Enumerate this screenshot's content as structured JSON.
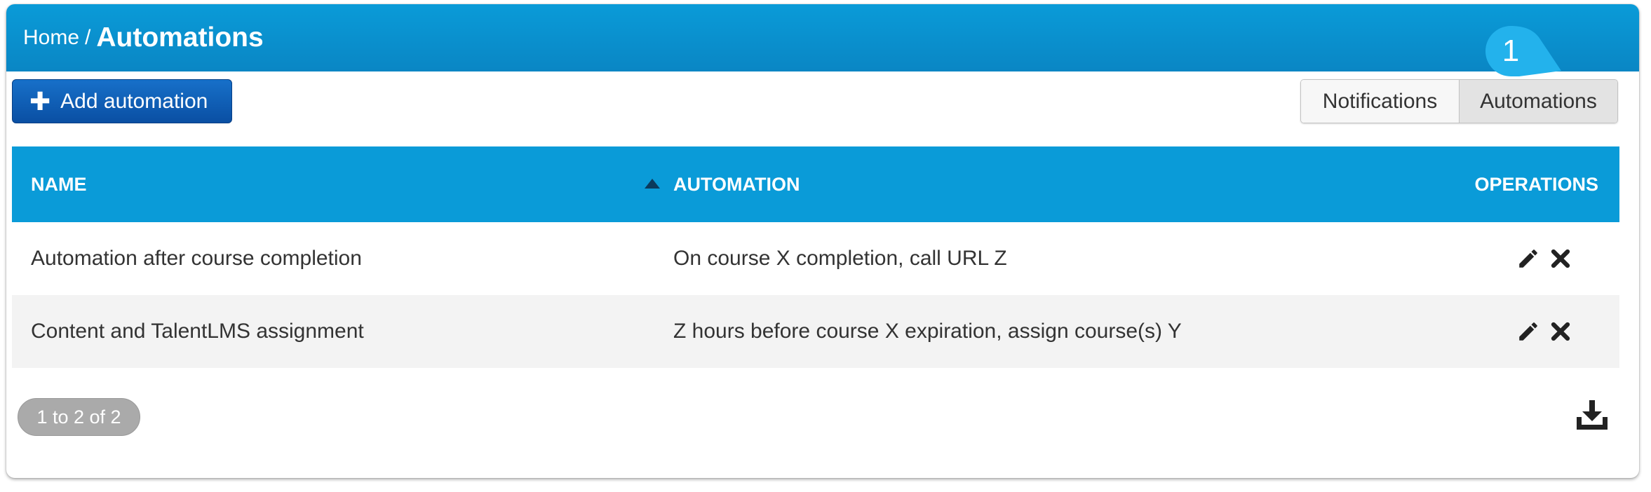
{
  "breadcrumb": {
    "home": "Home",
    "separator": "/",
    "current": "Automations"
  },
  "toolbar": {
    "add_label": "Add automation"
  },
  "view_toggle": {
    "options": [
      "Notifications",
      "Automations"
    ],
    "active": "Automations"
  },
  "tour_step": "1",
  "table": {
    "columns": [
      "NAME",
      "AUTOMATION",
      "OPERATIONS"
    ],
    "sort": {
      "column": "NAME",
      "direction": "ascending"
    },
    "rows": [
      {
        "name": "Automation after course completion",
        "automation": "On course X completion, call URL Z"
      },
      {
        "name": "Content and TalentLMS assignment",
        "automation": "Z hours before course X expiration, assign course(s) Y"
      }
    ]
  },
  "pagination": {
    "summary": "1 to 2 of 2"
  },
  "icons": {
    "add": "plus-icon",
    "sort": "sort-ascending-icon",
    "edit": "pencil-icon",
    "delete": "close-icon",
    "export": "download-icon"
  },
  "colors": {
    "header": "#0a9bd8",
    "primary_button": "#0a4fa3",
    "tour_bubble": "#23b2ec"
  }
}
